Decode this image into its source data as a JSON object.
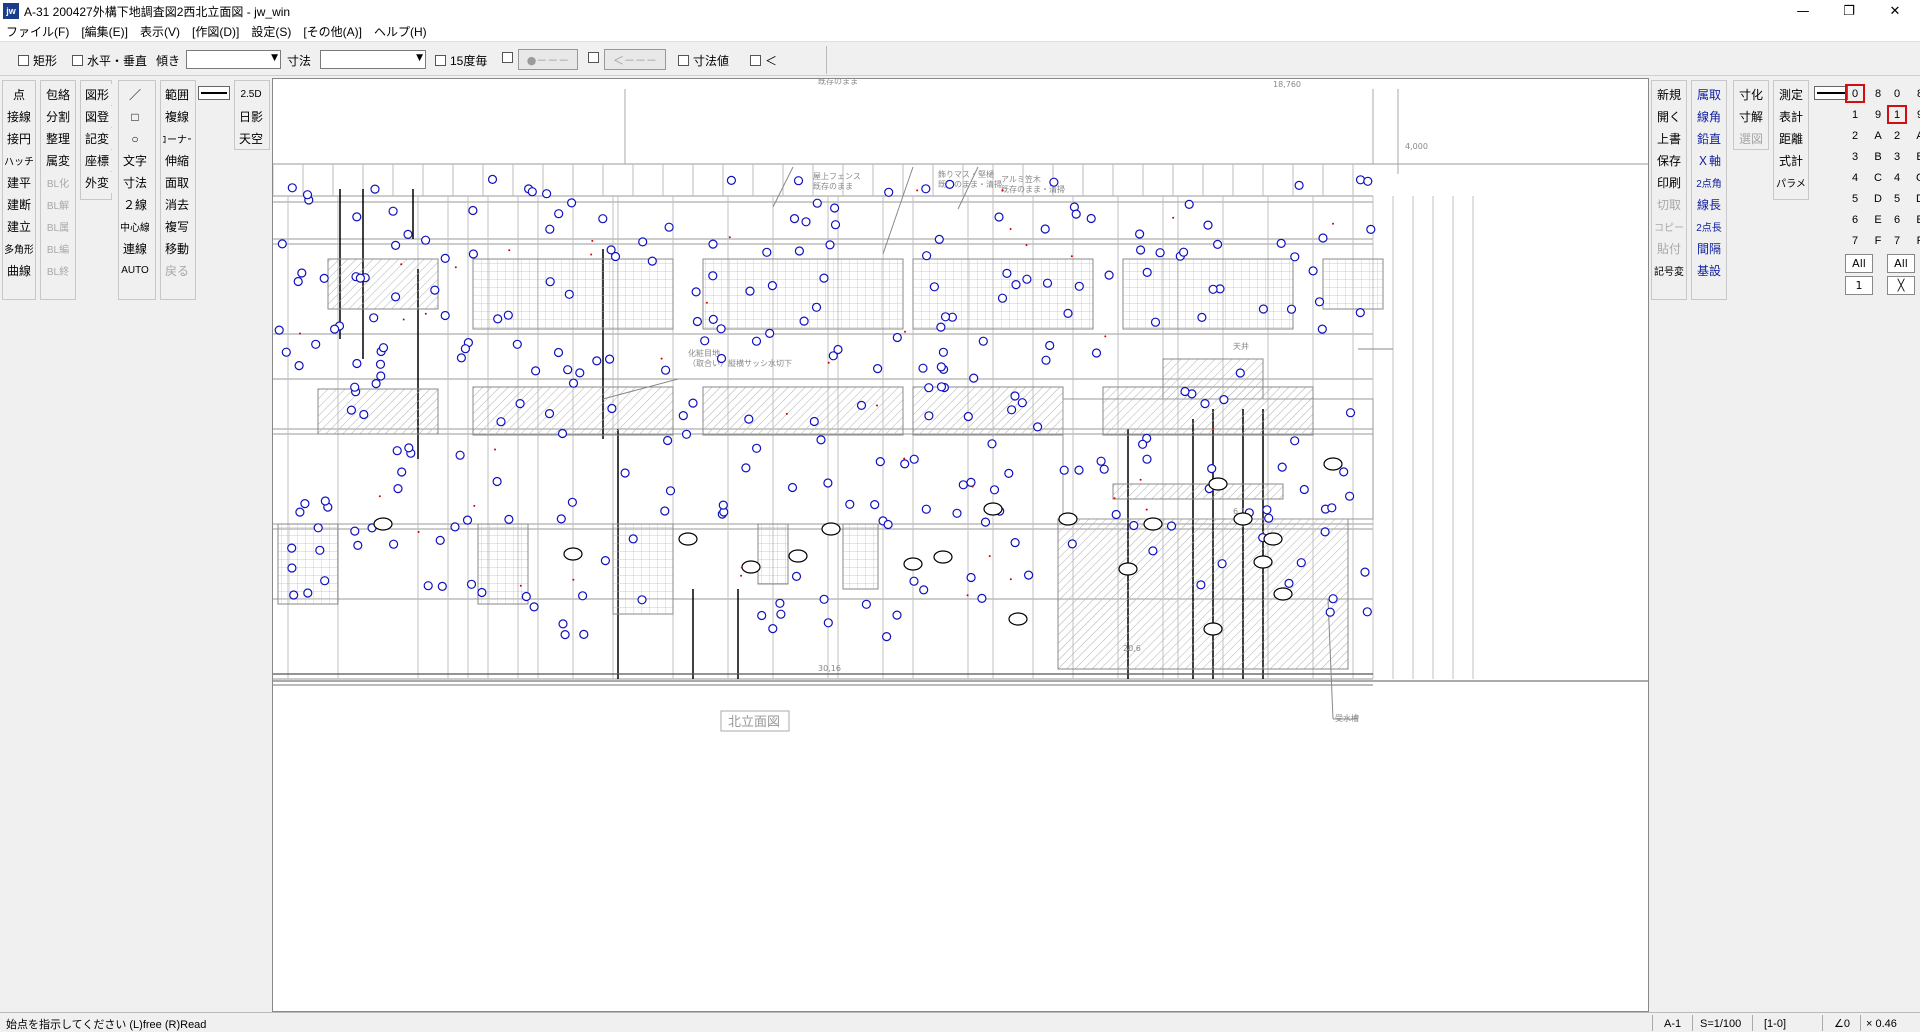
{
  "window": {
    "title": "A-31 200427外構下地調査図2西北立面図 - jw_win",
    "icon": "jw",
    "minimize": "—",
    "maximize": "❐",
    "close": "✕"
  },
  "menu": [
    "ファイル(F)",
    "[編集(E)]",
    "表示(V)",
    "[作図(D)]",
    "設定(S)",
    "[その他(A)]",
    "ヘルプ(H)"
  ],
  "toolbar": {
    "rect": "矩形",
    "horiz_vert": "水平・垂直",
    "slope": "傾き",
    "dimension": "寸法",
    "deg15": "15度毎",
    "btn_dots": "●－－－",
    "btn_arrow": "＜－－－",
    "dim_value": "寸法値",
    "lt": "＜"
  },
  "left_tools": {
    "col1": [
      "点",
      "接線",
      "接円",
      "ハッチ",
      "建平",
      "建断",
      "建立",
      "多角形",
      "曲線"
    ],
    "col2": [
      "包絡",
      "分割",
      "整理",
      "属変",
      "BL化",
      "BL解",
      "BL属",
      "BL編",
      "BL終"
    ],
    "col3": [
      "図形",
      "図登",
      "記変",
      "座標",
      "外変"
    ],
    "col4": [
      "／",
      "□",
      "○",
      "文字",
      "寸法",
      "２線",
      "中心線",
      "連線",
      "AUTO"
    ],
    "col5": [
      "範囲",
      "複線",
      "コーナー",
      "伸縮",
      "面取",
      "消去",
      "複写",
      "移動",
      "戻る"
    ],
    "col6": [
      "2.5D",
      "日影",
      "天空"
    ]
  },
  "right_tools": {
    "col1": [
      "新規",
      "開く",
      "上書",
      "保存",
      "印刷",
      "切取",
      "コピー",
      "貼付",
      "線記号変形"
    ],
    "col2": [
      "属取",
      "線角",
      "鉛直",
      "Ｘ軸",
      "2点角",
      "線長",
      "2点長",
      "間隔",
      "基設"
    ],
    "col3": [
      "寸化",
      "寸解",
      "選図"
    ],
    "col4": [
      "測定",
      "表計",
      "距離",
      "式計",
      "パラメ"
    ]
  },
  "layers": {
    "group_left": [
      [
        "0",
        "8"
      ],
      [
        "1",
        "9"
      ],
      [
        "2",
        "A"
      ],
      [
        "3",
        "B"
      ],
      [
        "4",
        "C"
      ],
      [
        "5",
        "D"
      ],
      [
        "6",
        "E"
      ],
      [
        "7",
        "F"
      ]
    ],
    "layer_right": [
      [
        "0",
        "8"
      ],
      [
        "1",
        "9"
      ],
      [
        "2",
        "A"
      ],
      [
        "3",
        "B"
      ],
      [
        "4",
        "C"
      ],
      [
        "5",
        "D"
      ],
      [
        "6",
        "E"
      ],
      [
        "7",
        "F"
      ]
    ],
    "all_left": "All",
    "all_right": "All",
    "bottom_left": "1",
    "bottom_right": "╳"
  },
  "drawing": {
    "title_label": "北立面図",
    "note1_line1": "屋上フェンス",
    "note1_line2": "既存のまま",
    "note2_line1": "飾りマス・堅樋",
    "note2_line2": "既存のまま・清掃",
    "note3_line1": "アルミ笠木",
    "note3_line2": "既存のまま・清掃",
    "note4_line1": "化粧目地",
    "note4_line2": "（取合い）縦横サッシ水切下",
    "note_top": "既存のまま",
    "dim_top": "18,760",
    "dim_side": "4,000",
    "dim_bottom": "30,16",
    "dim_bottom2": "20,6",
    "note_right": "受水槽",
    "note_right2": "天井",
    "small_label": "6,1"
  },
  "status": {
    "prompt": "始点を指示してください (L)free (R)Read",
    "paper": "A-1",
    "scale": "S=1/100",
    "layer": "[1-0]",
    "angle": "∠0",
    "zoom": "× 0.46"
  }
}
